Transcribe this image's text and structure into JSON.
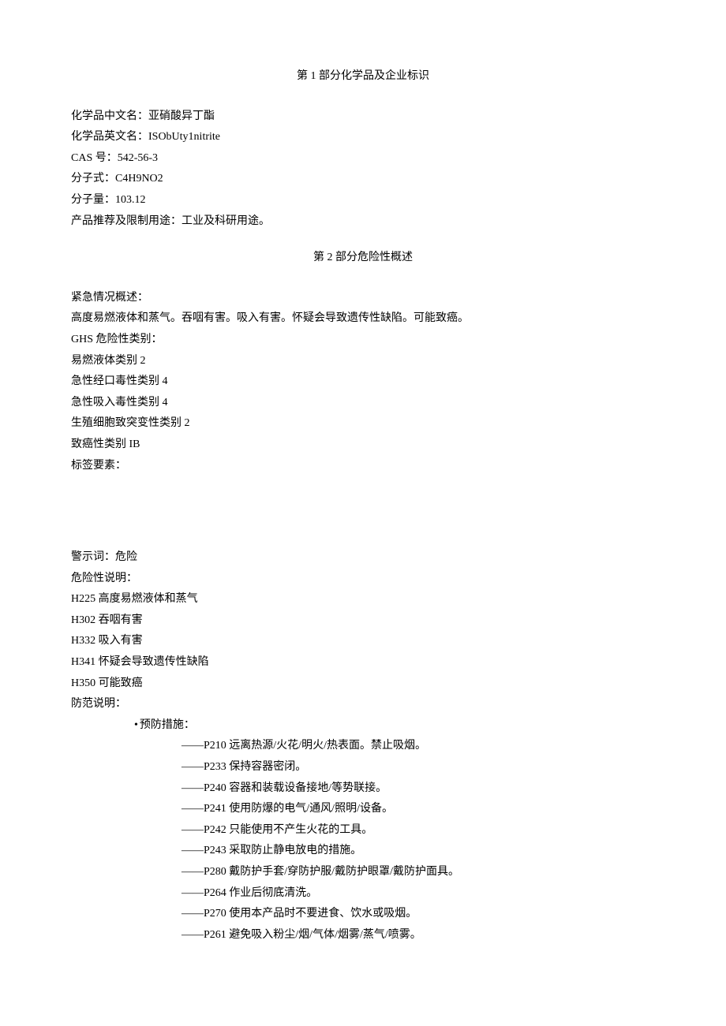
{
  "section1": {
    "title": "第 1 部分化学品及企业标识",
    "items": {
      "name_cn_label": "化学品中文名：亚硝酸异丁酯",
      "name_en_label": "化学品英文名：ISObUty1nitrite",
      "cas_label": "CAS 号：542-56-3",
      "formula_label": "分子式：C4H9NO2",
      "weight_label": "分子量：103.12",
      "usage_label": "产品推荐及限制用途：工业及科研用途。"
    }
  },
  "section2": {
    "title": "第 2 部分危险性概述",
    "emergency_label": "紧急情况概述：",
    "emergency_desc": "高度易燃液体和蒸气。吞咽有害。吸入有害。怀疑会导致遗传性缺陷。可能致癌。",
    "ghs_label": "GHS 危险性类别：",
    "ghs_categories": [
      "易燃液体类别 2",
      "急性经口毒性类别 4",
      "急性吸入毒性类别 4",
      "生殖细胞致突变性类别 2",
      "致癌性类别 IB"
    ],
    "label_elements": "标签要素：",
    "signal_word": "警示词：危险",
    "hazard_label": "危险性说明：",
    "hazard_statements": [
      "H225 高度易燃液体和蒸气",
      "H302 吞咽有害",
      "H332 吸入有害",
      "H341 怀疑会导致遗传性缺陷",
      "H350 可能致癌"
    ],
    "precaution_label": "防范说明：",
    "prevention_label": "预防措施：",
    "prevention_items": [
      "——P210 远离热源/火花/明火/热表面。禁止吸烟。",
      "——P233 保持容器密闭。",
      "——P240 容器和装载设备接地/等势联接。",
      "——P241 使用防爆的电气/通风/照明/设备。",
      "——P242 只能使用不产生火花的工具。",
      "——P243 采取防止静电放电的措施。",
      "——P280 戴防护手套/穿防护服/戴防护眼罩/戴防护面具。",
      "——P264 作业后彻底清洗。",
      "——P270 使用本产品时不要进食、饮水或吸烟。",
      "——P261 避免吸入粉尘/烟/气体/烟雾/蒸气/喷雾。"
    ]
  }
}
